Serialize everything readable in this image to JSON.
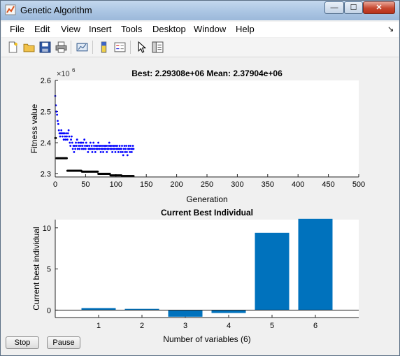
{
  "window": {
    "title": "Genetic Algorithm",
    "minimize_glyph": "—",
    "maximize_glyph": "☐",
    "close_glyph": "✕"
  },
  "menubar": {
    "items": [
      "File",
      "Edit",
      "View",
      "Insert",
      "Tools",
      "Desktop",
      "Window",
      "Help"
    ],
    "dock_glyph": "↘"
  },
  "toolbar": {
    "icons": [
      "new-figure-icon",
      "open-file-icon",
      "save-icon",
      "print-icon",
      "link-plot-icon",
      "colorbar-icon",
      "legend-icon",
      "pointer-icon",
      "property-editor-icon"
    ]
  },
  "buttons": {
    "stop_label": "Stop",
    "pause_label": "Pause"
  },
  "colors": {
    "accent": "#0072bd",
    "best": "#000000",
    "mean": "#0000ff"
  },
  "chart_data": [
    {
      "type": "scatter",
      "title": "Best: 2.29308e+06 Mean: 2.37904e+06",
      "xlabel": "Generation",
      "ylabel": "Fitness value",
      "exponent_label": "×10",
      "exponent": "6",
      "xlim": [
        0,
        500
      ],
      "ylim": [
        2.29,
        2.6
      ],
      "xticks": [
        0,
        50,
        100,
        150,
        200,
        250,
        300,
        350,
        400,
        450,
        500
      ],
      "yticks": [
        2.3,
        2.4,
        2.5,
        2.6
      ],
      "ytick_labels": [
        "2.3",
        "2.4",
        "2.5",
        "2.6"
      ],
      "grid": false,
      "series": [
        {
          "points": [
            [
              0,
              2.55
            ],
            [
              1,
              2.52
            ],
            [
              2,
              2.5
            ],
            [
              3,
              2.49
            ],
            [
              4,
              2.47
            ],
            [
              5,
              2.46
            ],
            [
              6,
              2.44
            ],
            [
              7,
              2.43
            ],
            [
              8,
              2.42
            ],
            [
              9,
              2.43
            ],
            [
              10,
              2.44
            ],
            [
              11,
              2.43
            ],
            [
              12,
              2.42
            ],
            [
              13,
              2.43
            ],
            [
              14,
              2.41
            ],
            [
              15,
              2.43
            ],
            [
              16,
              2.42
            ],
            [
              17,
              2.41
            ],
            [
              18,
              2.43
            ],
            [
              19,
              2.42
            ],
            [
              20,
              2.41
            ],
            [
              21,
              2.43
            ],
            [
              22,
              2.44
            ],
            [
              23,
              2.42
            ],
            [
              24,
              2.4
            ],
            [
              25,
              2.39
            ],
            [
              26,
              2.41
            ],
            [
              27,
              2.42
            ],
            [
              28,
              2.4
            ],
            [
              29,
              2.38
            ],
            [
              30,
              2.39
            ],
            [
              31,
              2.37
            ],
            [
              32,
              2.39
            ],
            [
              33,
              2.38
            ],
            [
              34,
              2.4
            ],
            [
              35,
              2.39
            ],
            [
              36,
              2.41
            ],
            [
              37,
              2.38
            ],
            [
              38,
              2.4
            ],
            [
              39,
              2.39
            ],
            [
              40,
              2.38
            ],
            [
              41,
              2.4
            ],
            [
              42,
              2.39
            ],
            [
              43,
              2.4
            ],
            [
              44,
              2.38
            ],
            [
              45,
              2.39
            ],
            [
              46,
              2.4
            ],
            [
              47,
              2.38
            ],
            [
              48,
              2.41
            ],
            [
              49,
              2.39
            ],
            [
              50,
              2.38
            ],
            [
              51,
              2.4
            ],
            [
              52,
              2.39
            ],
            [
              53,
              2.39
            ],
            [
              54,
              2.37
            ],
            [
              55,
              2.38
            ],
            [
              56,
              2.39
            ],
            [
              57,
              2.38
            ],
            [
              58,
              2.4
            ],
            [
              59,
              2.38
            ],
            [
              60,
              2.39
            ],
            [
              61,
              2.37
            ],
            [
              62,
              2.38
            ],
            [
              63,
              2.4
            ],
            [
              64,
              2.39
            ],
            [
              65,
              2.38
            ],
            [
              66,
              2.37
            ],
            [
              67,
              2.39
            ],
            [
              68,
              2.38
            ],
            [
              69,
              2.39
            ],
            [
              70,
              2.38
            ],
            [
              71,
              2.4
            ],
            [
              72,
              2.39
            ],
            [
              73,
              2.38
            ],
            [
              74,
              2.39
            ],
            [
              75,
              2.37
            ],
            [
              76,
              2.38
            ],
            [
              77,
              2.39
            ],
            [
              78,
              2.38
            ],
            [
              79,
              2.37
            ],
            [
              80,
              2.39
            ],
            [
              81,
              2.38
            ],
            [
              82,
              2.39
            ],
            [
              83,
              2.38
            ],
            [
              84,
              2.39
            ],
            [
              85,
              2.37
            ],
            [
              86,
              2.38
            ],
            [
              87,
              2.39
            ],
            [
              88,
              2.38
            ],
            [
              89,
              2.4
            ],
            [
              90,
              2.39
            ],
            [
              91,
              2.38
            ],
            [
              92,
              2.39
            ],
            [
              93,
              2.38
            ],
            [
              94,
              2.37
            ],
            [
              95,
              2.39
            ],
            [
              96,
              2.38
            ],
            [
              97,
              2.39
            ],
            [
              98,
              2.38
            ],
            [
              99,
              2.37
            ],
            [
              100,
              2.39
            ],
            [
              101,
              2.38
            ],
            [
              102,
              2.39
            ],
            [
              103,
              2.38
            ],
            [
              104,
              2.37
            ],
            [
              105,
              2.38
            ],
            [
              106,
              2.39
            ],
            [
              107,
              2.38
            ],
            [
              108,
              2.37
            ],
            [
              109,
              2.38
            ],
            [
              110,
              2.39
            ],
            [
              111,
              2.37
            ],
            [
              112,
              2.36
            ],
            [
              113,
              2.38
            ],
            [
              114,
              2.39
            ],
            [
              115,
              2.37
            ],
            [
              116,
              2.38
            ],
            [
              117,
              2.39
            ],
            [
              118,
              2.37
            ],
            [
              119,
              2.36
            ],
            [
              120,
              2.38
            ],
            [
              121,
              2.39
            ],
            [
              122,
              2.38
            ],
            [
              123,
              2.37
            ],
            [
              124,
              2.39
            ],
            [
              125,
              2.38
            ],
            [
              126,
              2.37
            ],
            [
              127,
              2.38
            ],
            [
              128,
              2.39
            ],
            [
              129,
              2.38
            ]
          ]
        },
        {
          "points": [
            [
              0,
              2.415
            ],
            [
              1,
              2.415
            ],
            [
              2,
              2.35
            ],
            [
              3,
              2.35
            ],
            [
              4,
              2.35
            ],
            [
              5,
              2.35
            ],
            [
              6,
              2.35
            ],
            [
              7,
              2.35
            ],
            [
              8,
              2.35
            ],
            [
              9,
              2.35
            ],
            [
              10,
              2.35
            ],
            [
              11,
              2.35
            ],
            [
              12,
              2.35
            ],
            [
              13,
              2.35
            ],
            [
              14,
              2.35
            ],
            [
              15,
              2.35
            ],
            [
              16,
              2.35
            ],
            [
              17,
              2.35
            ],
            [
              18,
              2.35
            ],
            [
              19,
              2.35
            ],
            [
              20,
              2.31
            ],
            [
              21,
              2.31
            ],
            [
              22,
              2.31
            ],
            [
              23,
              2.31
            ],
            [
              24,
              2.31
            ],
            [
              25,
              2.31
            ],
            [
              26,
              2.31
            ],
            [
              27,
              2.31
            ],
            [
              28,
              2.31
            ],
            [
              29,
              2.31
            ],
            [
              30,
              2.31
            ],
            [
              31,
              2.31
            ],
            [
              32,
              2.31
            ],
            [
              33,
              2.31
            ],
            [
              34,
              2.31
            ],
            [
              35,
              2.31
            ],
            [
              36,
              2.31
            ],
            [
              37,
              2.31
            ],
            [
              38,
              2.31
            ],
            [
              39,
              2.31
            ],
            [
              40,
              2.31
            ],
            [
              41,
              2.31
            ],
            [
              42,
              2.31
            ],
            [
              43,
              2.31
            ],
            [
              44,
              2.307
            ],
            [
              45,
              2.307
            ],
            [
              46,
              2.307
            ],
            [
              47,
              2.307
            ],
            [
              48,
              2.307
            ],
            [
              49,
              2.307
            ],
            [
              50,
              2.307
            ],
            [
              51,
              2.307
            ],
            [
              52,
              2.307
            ],
            [
              53,
              2.307
            ],
            [
              54,
              2.307
            ],
            [
              55,
              2.307
            ],
            [
              56,
              2.307
            ],
            [
              57,
              2.307
            ],
            [
              58,
              2.307
            ],
            [
              59,
              2.307
            ],
            [
              60,
              2.307
            ],
            [
              61,
              2.307
            ],
            [
              62,
              2.307
            ],
            [
              63,
              2.307
            ],
            [
              64,
              2.307
            ],
            [
              65,
              2.307
            ],
            [
              66,
              2.307
            ],
            [
              67,
              2.307
            ],
            [
              68,
              2.307
            ],
            [
              69,
              2.307
            ],
            [
              70,
              2.307
            ],
            [
              71,
              2.3
            ],
            [
              72,
              2.3
            ],
            [
              73,
              2.3
            ],
            [
              74,
              2.3
            ],
            [
              75,
              2.3
            ],
            [
              76,
              2.3
            ],
            [
              77,
              2.3
            ],
            [
              78,
              2.3
            ],
            [
              79,
              2.3
            ],
            [
              80,
              2.3
            ],
            [
              81,
              2.3
            ],
            [
              82,
              2.3
            ],
            [
              83,
              2.3
            ],
            [
              84,
              2.3
            ],
            [
              85,
              2.3
            ],
            [
              86,
              2.3
            ],
            [
              87,
              2.3
            ],
            [
              88,
              2.3
            ],
            [
              89,
              2.3
            ],
            [
              90,
              2.3
            ],
            [
              91,
              2.295
            ],
            [
              92,
              2.295
            ],
            [
              93,
              2.295
            ],
            [
              94,
              2.295
            ],
            [
              95,
              2.295
            ],
            [
              96,
              2.295
            ],
            [
              97,
              2.295
            ],
            [
              98,
              2.295
            ],
            [
              99,
              2.295
            ],
            [
              100,
              2.295
            ],
            [
              101,
              2.295
            ],
            [
              102,
              2.295
            ],
            [
              103,
              2.295
            ],
            [
              104,
              2.295
            ],
            [
              105,
              2.295
            ],
            [
              106,
              2.295
            ],
            [
              107,
              2.295
            ],
            [
              108,
              2.295
            ],
            [
              109,
              2.295
            ],
            [
              110,
              2.293
            ],
            [
              111,
              2.293
            ],
            [
              112,
              2.293
            ],
            [
              113,
              2.293
            ],
            [
              114,
              2.293
            ],
            [
              115,
              2.293
            ],
            [
              116,
              2.293
            ],
            [
              117,
              2.293
            ],
            [
              118,
              2.293
            ],
            [
              119,
              2.293
            ],
            [
              120,
              2.293
            ],
            [
              121,
              2.293
            ],
            [
              122,
              2.293
            ],
            [
              123,
              2.293
            ],
            [
              124,
              2.293
            ],
            [
              125,
              2.293
            ],
            [
              126,
              2.293
            ],
            [
              127,
              2.293
            ],
            [
              128,
              2.293
            ],
            [
              129,
              2.293
            ]
          ]
        }
      ]
    },
    {
      "type": "bar",
      "title": "Current Best Individual",
      "xlabel": "Number of variables (6)",
      "ylabel": "Current best individual",
      "categories": [
        "1",
        "2",
        "3",
        "4",
        "5",
        "6"
      ],
      "values": [
        0.25,
        0.15,
        -0.8,
        -0.35,
        9.4,
        11.1
      ],
      "ylim": [
        -0.9,
        11
      ],
      "yticks": [
        0,
        5,
        10
      ],
      "grid": false
    }
  ]
}
